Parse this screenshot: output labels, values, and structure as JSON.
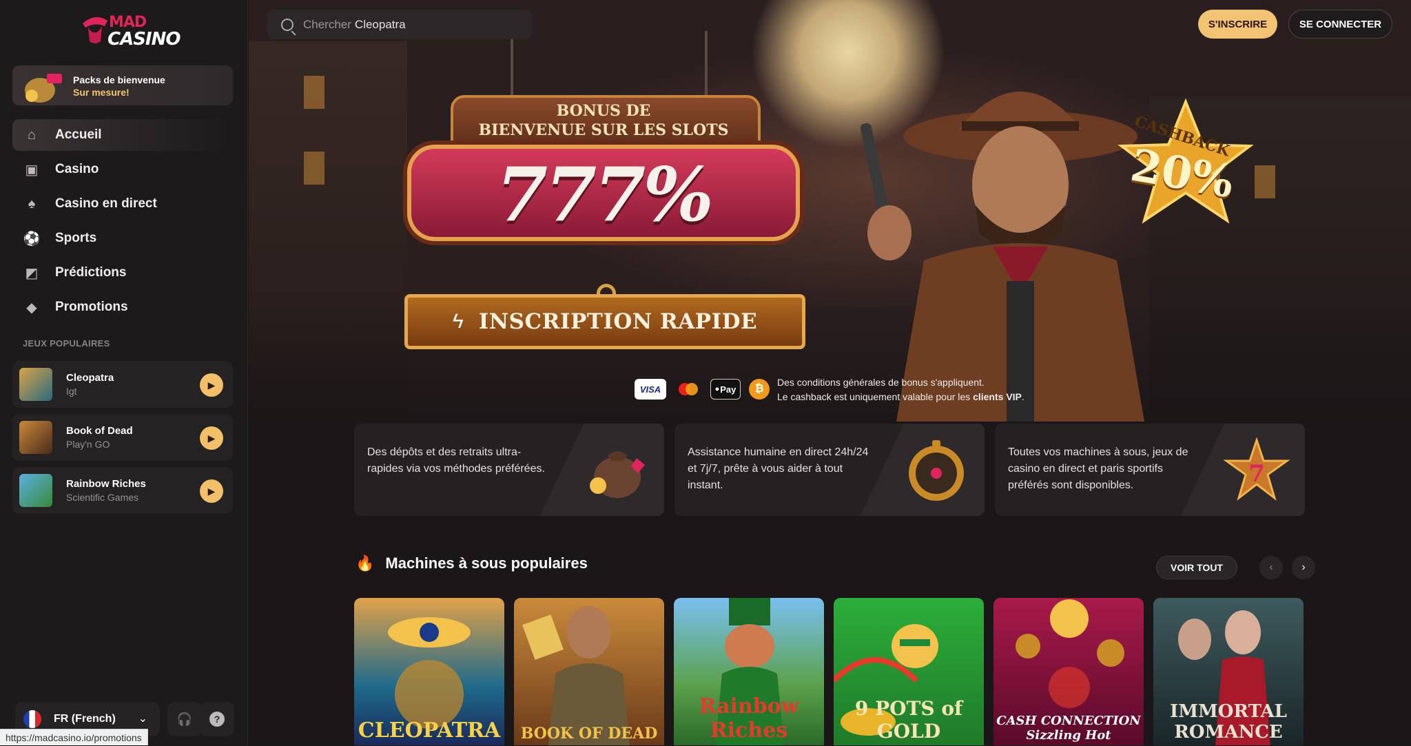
{
  "brand": {
    "line1": "MAD",
    "line2": "CASINO"
  },
  "welcome": {
    "line1": "Packs de bienvenue",
    "line2": "Sur mesure!"
  },
  "nav": [
    {
      "label": "Accueil",
      "icon": "saloon-icon",
      "active": true
    },
    {
      "label": "Casino",
      "icon": "slot-machine-icon"
    },
    {
      "label": "Casino en direct",
      "icon": "cards-icon"
    },
    {
      "label": "Sports",
      "icon": "soccer-ball-icon"
    },
    {
      "label": "Prédictions",
      "icon": "chart-card-icon"
    },
    {
      "label": "Promotions",
      "icon": "diamond-icon"
    }
  ],
  "popular_label": "JEUX POPULAIRES",
  "popular_games": [
    {
      "name": "Cleopatra",
      "provider": "Igt"
    },
    {
      "name": "Book of Dead",
      "provider": "Play'n GO"
    },
    {
      "name": "Rainbow Riches",
      "provider": "Scientific Games"
    }
  ],
  "language": {
    "label": "FR (French)"
  },
  "status_url": "https://madcasino.io/promotions",
  "search": {
    "placeholder": "Chercher",
    "value": "Cleopatra"
  },
  "header": {
    "register": "S'INSCRIRE",
    "login": "SE CONNECTER"
  },
  "hero": {
    "bonus_line1": "BONUS DE",
    "bonus_line2": "BIENVENUE SUR LES SLOTS",
    "bonus_value": "777%",
    "cta": "INSCRIPTION RAPIDE",
    "cashback_label": "CASHBACK",
    "cashback_value": "20%",
    "payments": [
      "VISA",
      "Pay",
      "₿"
    ],
    "terms_line1": "Des conditions générales de bonus s'appliquent.",
    "terms_line2_prefix": "Le cashback est uniquement valable pour les ",
    "terms_line2_bold": "clients VIP",
    "terms_line2_suffix": "."
  },
  "features": [
    {
      "text": "Des dépôts et des retraits ultra-rapides via vos méthodes préférées.",
      "icon": "money-bag-icon"
    },
    {
      "text": "Assistance humaine en direct 24h/24 et 7j/7, prête à vous aider à tout instant.",
      "icon": "compass-icon"
    },
    {
      "text": "Toutes vos machines à sous, jeux de casino en direct et paris sportifs préférés sont disponibles.",
      "icon": "sheriff-star-icon"
    }
  ],
  "slots_section": {
    "title": "Machines à sous populaires",
    "see_all": "VOIR TOUT"
  },
  "slots": [
    {
      "name": "CLEOPATRA",
      "color": "#1f6a8a"
    },
    {
      "name": "BOOK OF DEAD",
      "color": "#8a5a2a"
    },
    {
      "name": "Rainbow Riches",
      "color": "#3e8a3a"
    },
    {
      "name": "9 POTS of GOLD",
      "color": "#2c9a3a"
    },
    {
      "name": "CASH CONNECTION Sizzling Hot",
      "color": "#7a1a3a"
    },
    {
      "name": "IMMORTAL ROMANCE",
      "color": "#2a3a3e"
    }
  ],
  "colors": {
    "accent": "#f3c374",
    "sidebar": "#1c1a1b",
    "brand_red": "#e0245e"
  }
}
